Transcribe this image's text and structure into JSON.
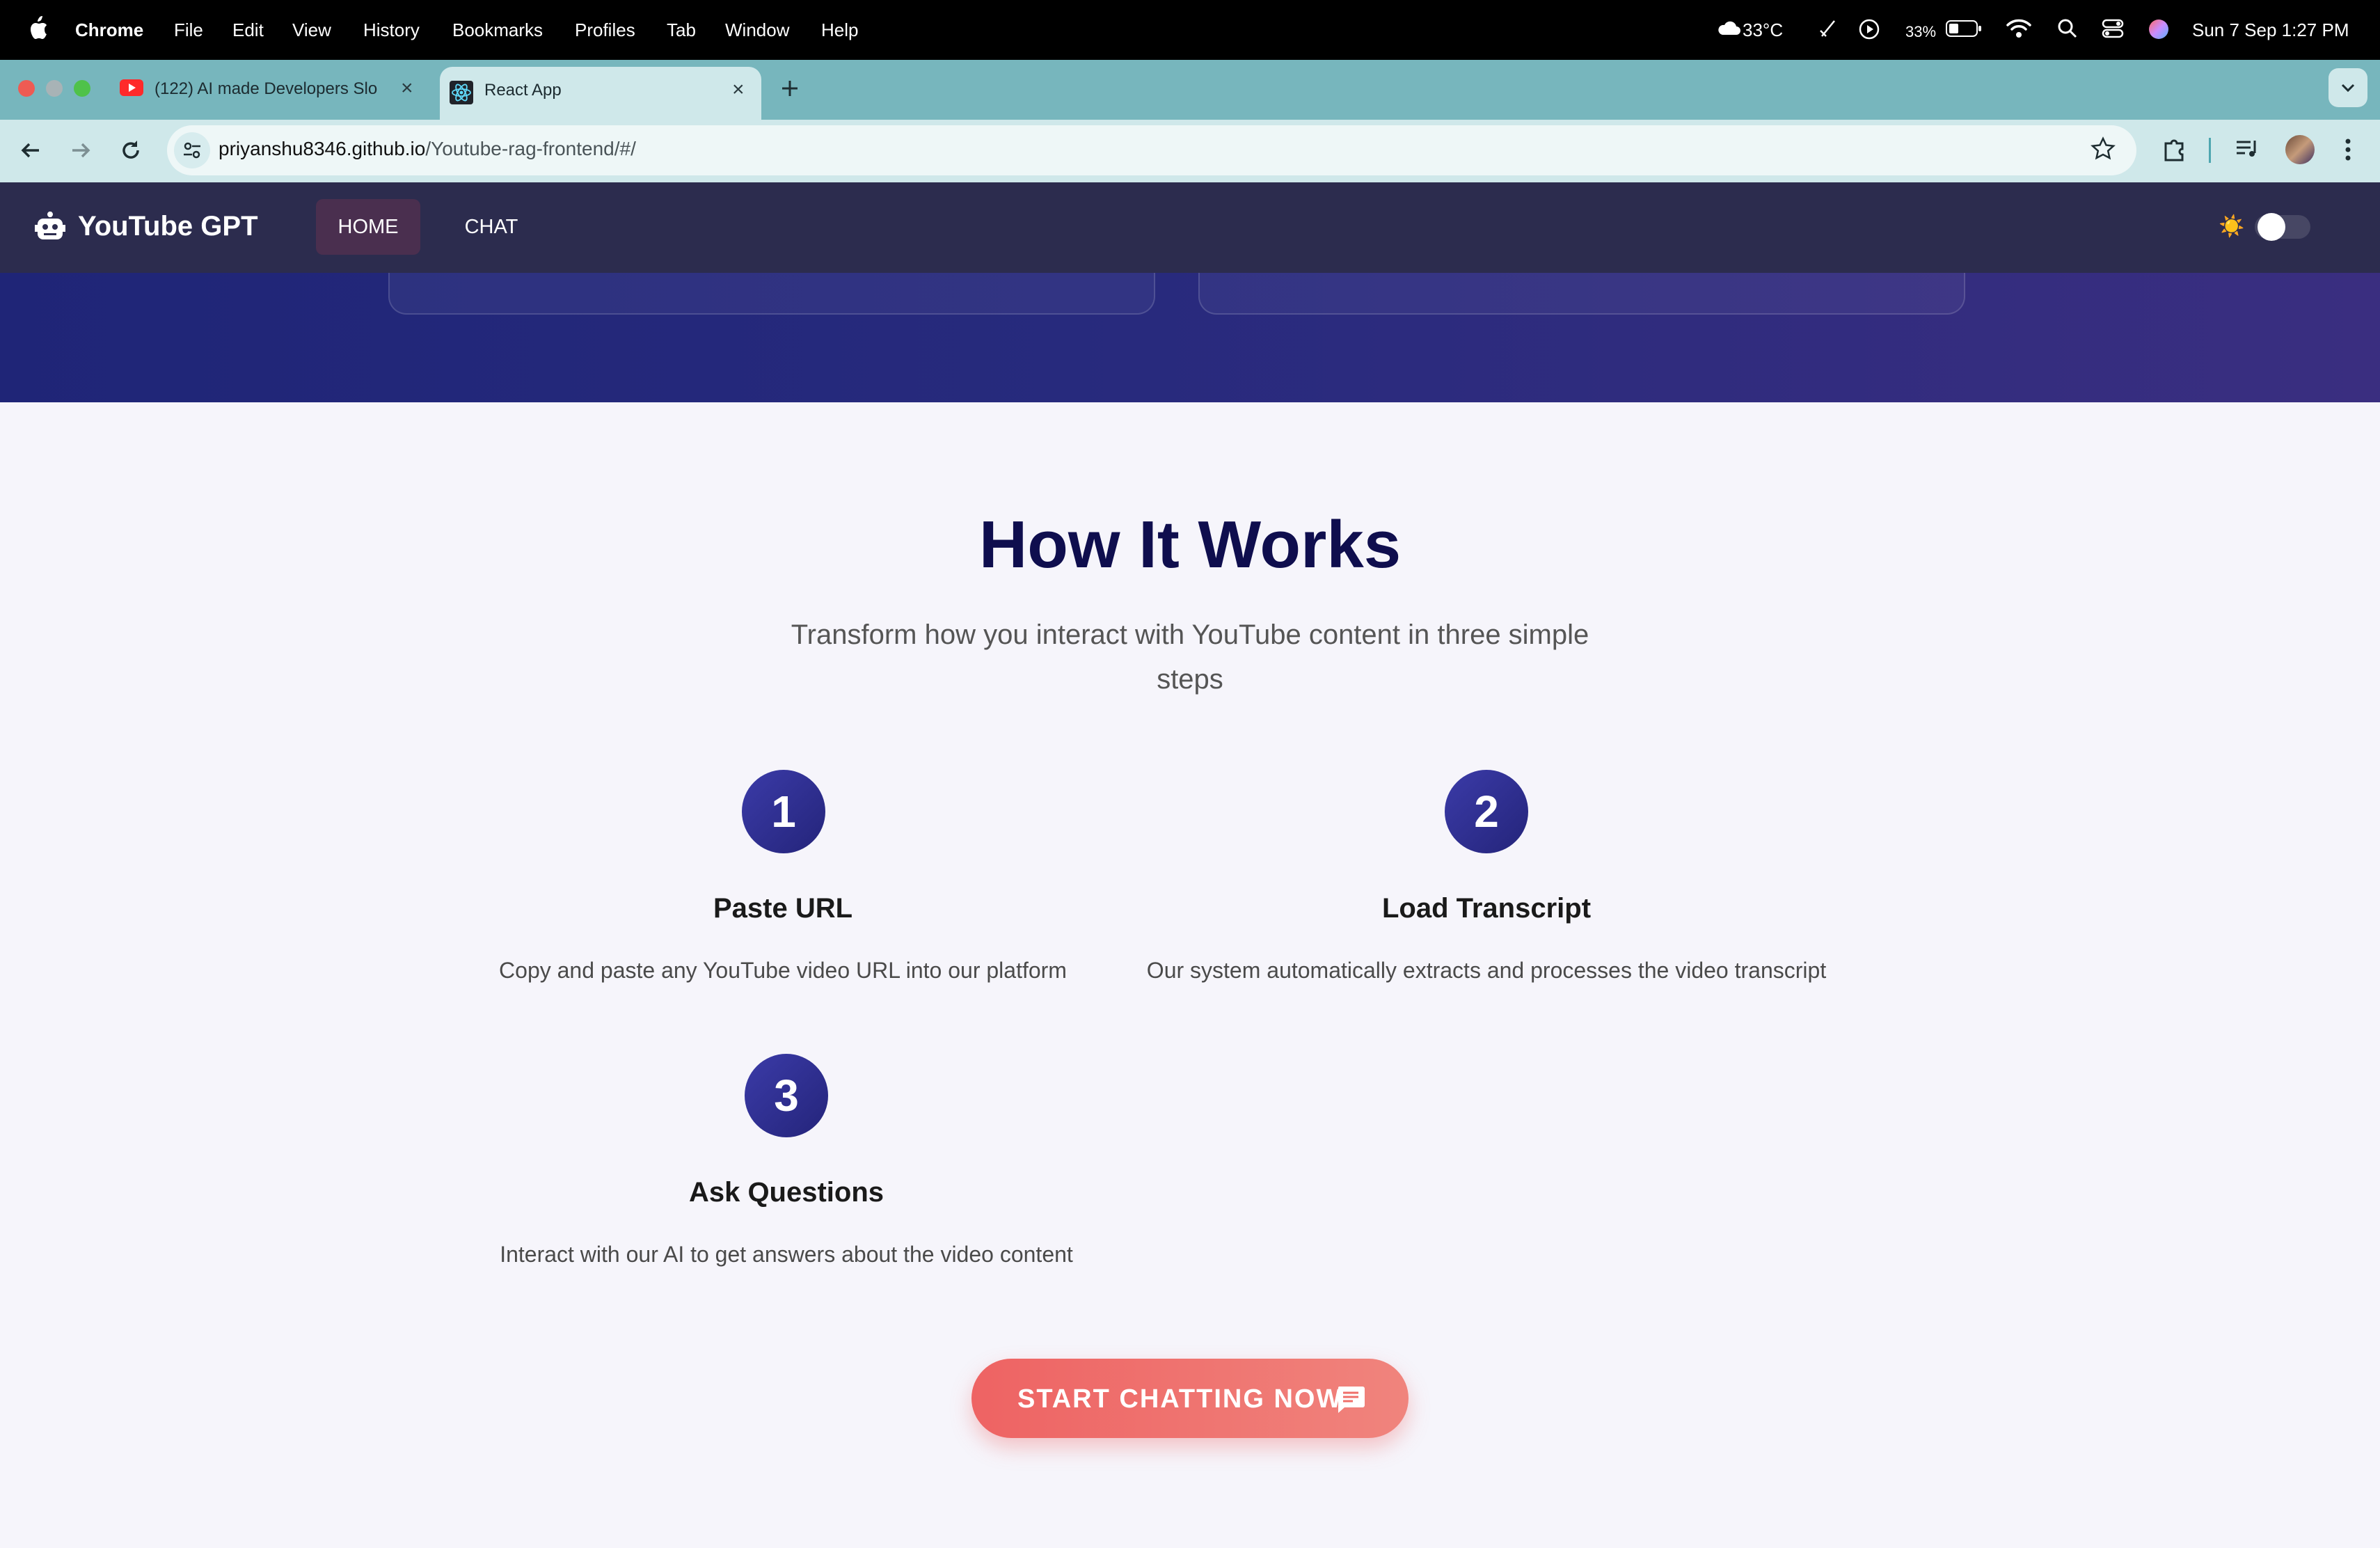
{
  "menubar": {
    "items": [
      "Chrome",
      "File",
      "Edit",
      "View",
      "History",
      "Bookmarks",
      "Profiles",
      "Tab",
      "Window",
      "Help"
    ],
    "weather": "33°C",
    "battery": "33%",
    "datetime": "Sun 7 Sep  1:27 PM"
  },
  "browser": {
    "tabs": [
      {
        "title": "(122) AI made Developers Slo",
        "icon": "youtube-icon"
      },
      {
        "title": "React App",
        "icon": "react-icon"
      }
    ],
    "url_host": "priyanshu8346.github.io",
    "url_path": "/Youtube-rag-frontend/#/"
  },
  "app": {
    "brand": "YouTube GPT",
    "nav": {
      "home": "HOME",
      "chat": "CHAT"
    },
    "theme_icon": "☀️"
  },
  "how": {
    "title": "How It Works",
    "subtitle": "Transform how you interact with YouTube content in three simple steps",
    "steps": [
      {
        "number": "1",
        "title": "Paste URL",
        "desc": "Copy and paste any YouTube video URL into our platform"
      },
      {
        "number": "2",
        "title": "Load Transcript",
        "desc": "Our system automatically extracts and processes the video transcript"
      },
      {
        "number": "3",
        "title": "Ask Questions",
        "desc": "Interact with our AI to get answers about the video content"
      }
    ],
    "cta": "START CHATTING NOW"
  },
  "colors": {
    "accent_navy": "#0f0e4e",
    "badge": "#2e2e8f",
    "cta": "#ee6363",
    "nav_bg": "#2c2c4e",
    "hero": "#272a7d"
  }
}
